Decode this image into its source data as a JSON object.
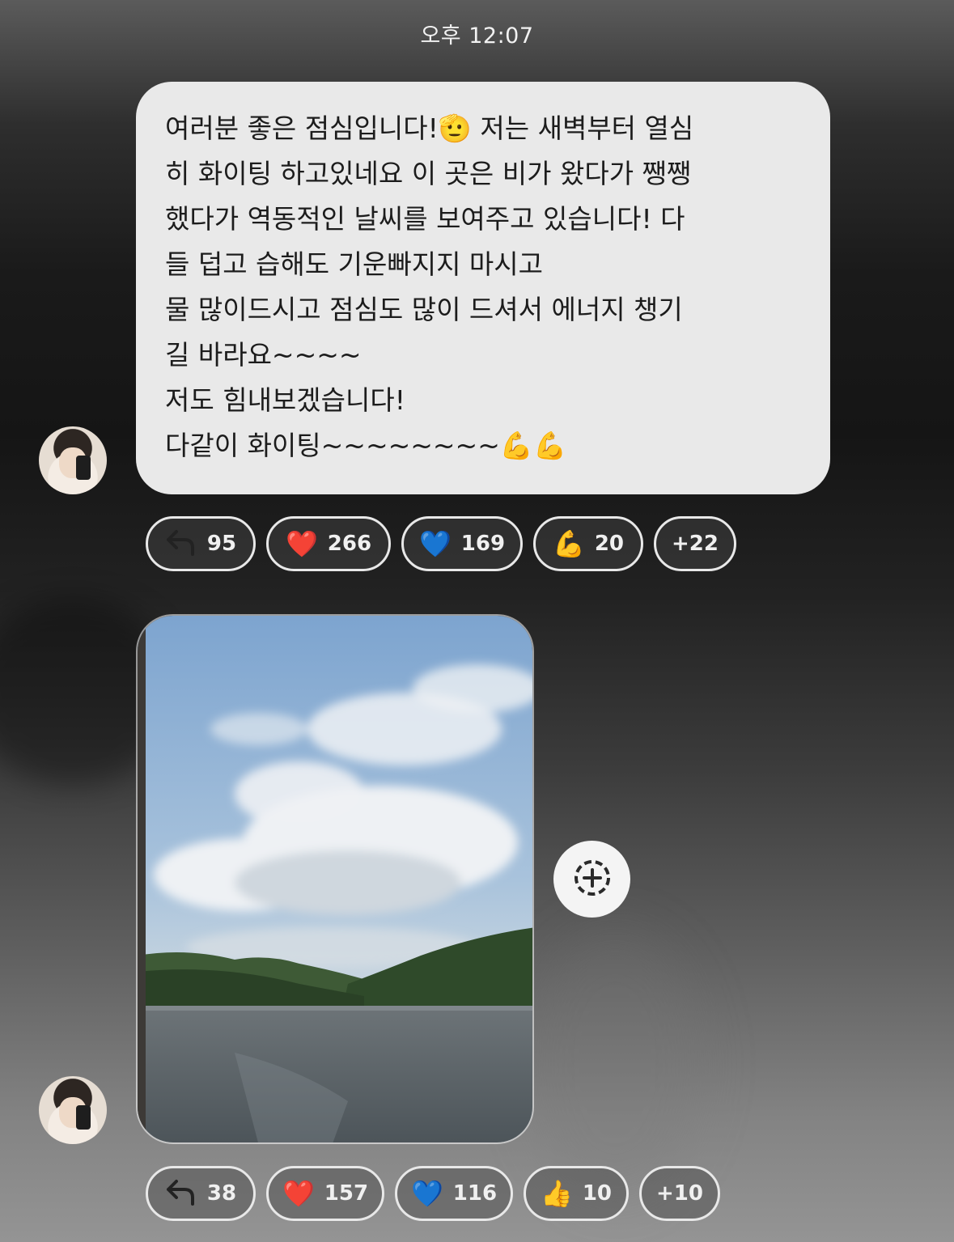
{
  "timestamp": "오후 12:07",
  "message1": {
    "lines": [
      "여러분 좋은 점심입니다!🫡 저는 새벽부터 열심",
      "히 화이팅 하고있네요 이 곳은 비가 왔다가 쨍쨍",
      "했다가 역동적인 날씨를 보여주고 있습니다! 다",
      "들 덥고 습해도 기운빠지지 마시고",
      "물 많이드시고 점심도 많이 드셔서 에너지 챙기",
      "길 바라요~~~~",
      "저도 힘내보겠습니다!",
      "다같이 화이팅~~~~~~~~💪💪"
    ]
  },
  "reactions1": [
    {
      "icon": "reply-icon",
      "emoji": "↩",
      "count": "95"
    },
    {
      "icon": "red-heart-icon",
      "emoji": "❤️",
      "count": "266"
    },
    {
      "icon": "blue-heart-icon",
      "emoji": "💙",
      "count": "169"
    },
    {
      "icon": "flexed-biceps-icon",
      "emoji": "💪",
      "count": "20"
    },
    {
      "icon": "more-reactions",
      "emoji": "",
      "count": "+22"
    }
  ],
  "reactions2": [
    {
      "icon": "reply-icon",
      "emoji": "↩",
      "count": "38"
    },
    {
      "icon": "red-heart-icon",
      "emoji": "❤️",
      "count": "157"
    },
    {
      "icon": "blue-heart-icon",
      "emoji": "💙",
      "count": "116"
    },
    {
      "icon": "thumbs-up-icon",
      "emoji": "👍",
      "count": "10"
    },
    {
      "icon": "more-reactions",
      "emoji": "",
      "count": "+10"
    }
  ],
  "colors": {
    "bubble": "#e9e9e9",
    "chip_border": "#e8e8e8",
    "text_light": "#f0f0f0"
  }
}
